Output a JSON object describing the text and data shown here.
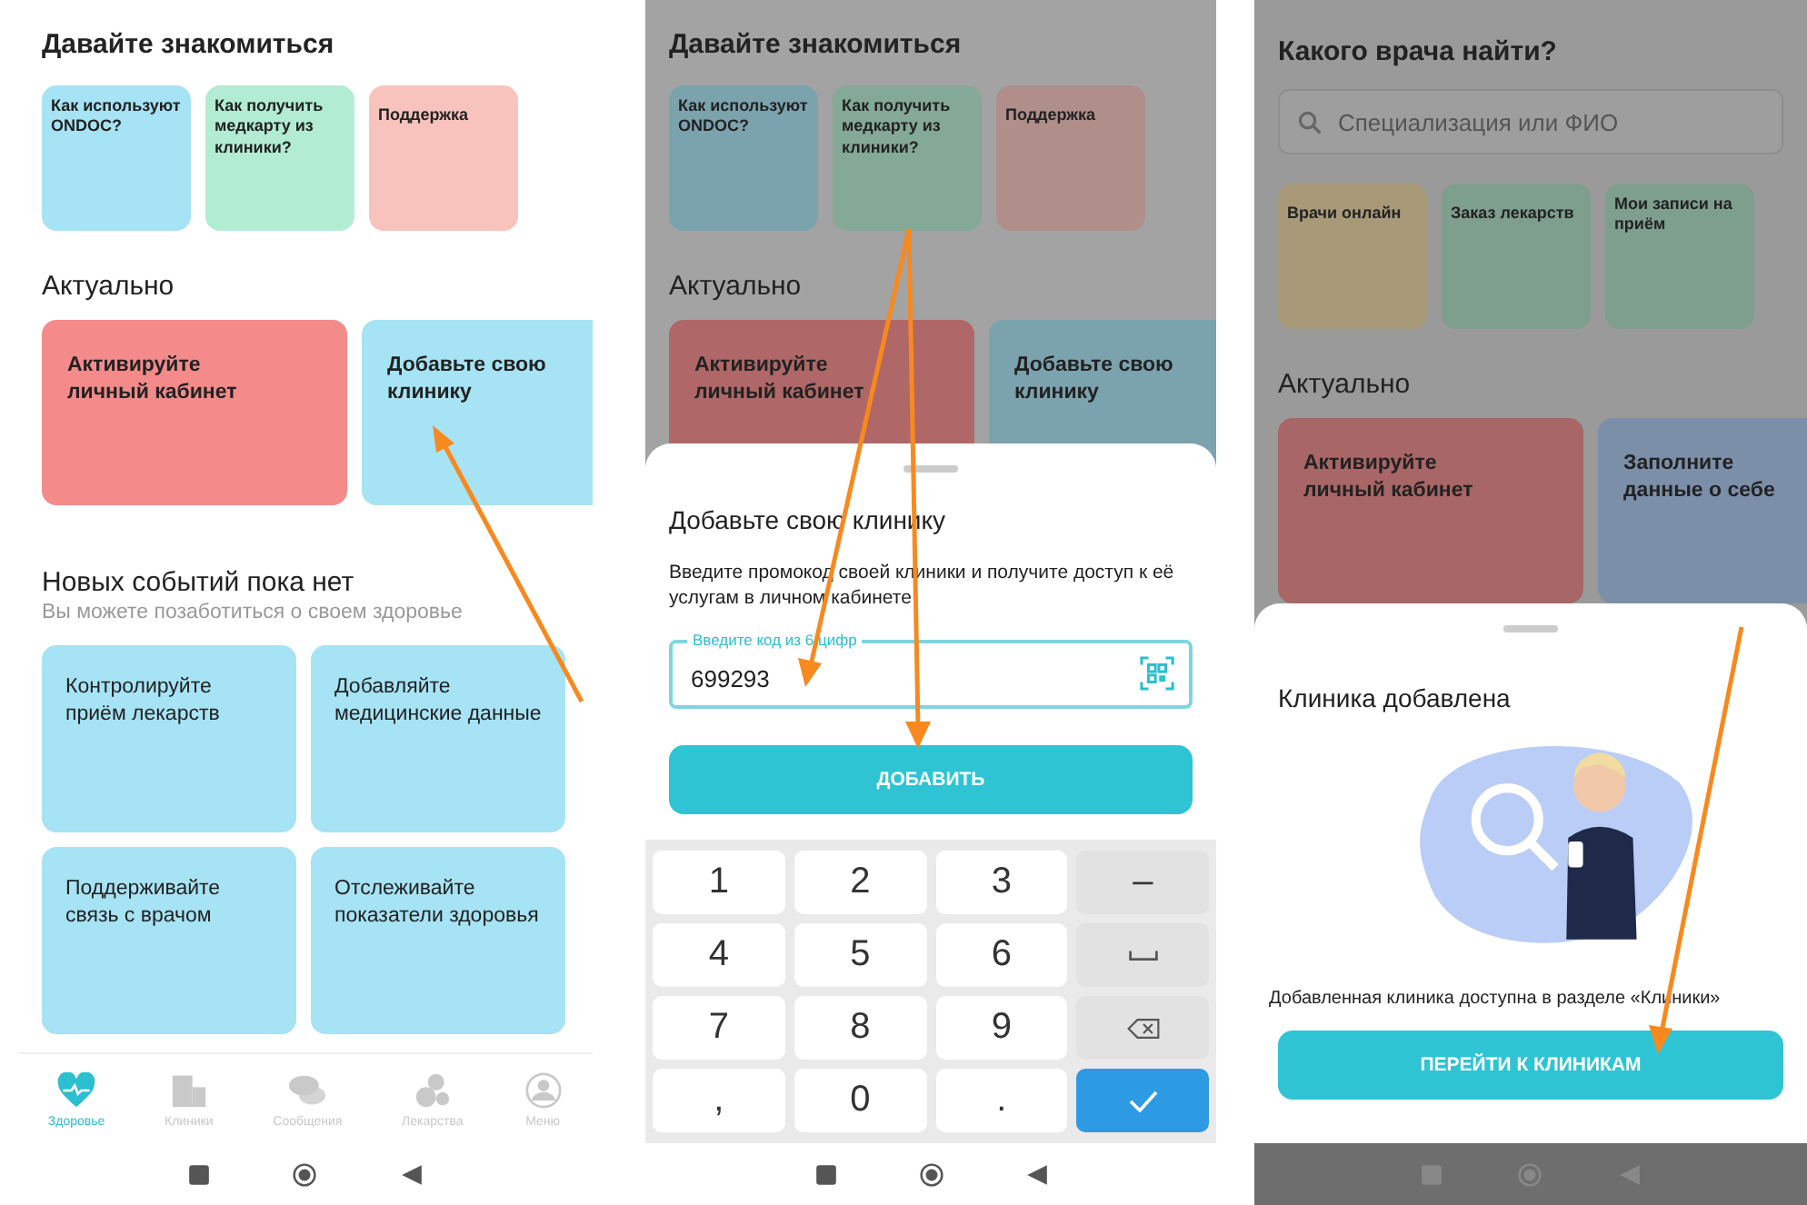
{
  "home": {
    "intro_title": "Давайте знакомиться",
    "intro_cards": [
      {
        "text": "Как используют ONDOC?",
        "color": "#a6e3f4"
      },
      {
        "text": "Как получить медкарту из клиники?",
        "color": "#b2ecd2"
      },
      {
        "text": "Поддержка",
        "color": "#f8c3bc"
      }
    ],
    "actual_title": "Актуально",
    "actual_cards": [
      {
        "text": "Активируйте личный кабинет",
        "color": "#f48a8a"
      },
      {
        "text": "Добавьте свою клинику",
        "color": "#a6e3f4"
      }
    ],
    "events_title": "Новых событий пока нет",
    "events_subtitle": "Вы можете позаботиться о своем здоровье",
    "tips": [
      "Контролируйте приём лекарств",
      "Добавляйте медицинские данные",
      "Поддерживайте связь с врачом",
      "Отслеживайте показатели здоровья"
    ],
    "nav": [
      {
        "label": "Здоровье",
        "selected": true
      },
      {
        "label": "Клиники",
        "selected": false
      },
      {
        "label": "Сообщения",
        "selected": false
      },
      {
        "label": "Лекарства",
        "selected": false
      },
      {
        "label": "Меню",
        "selected": false
      }
    ]
  },
  "add_clinic": {
    "background": {
      "intro_title": "Давайте знакомиться",
      "intro_cards": [
        {
          "text": "Как используют ONDOC?",
          "color": "#7ba3ae"
        },
        {
          "text": "Как получить медкарту из клиники?",
          "color": "#84a996"
        },
        {
          "text": "Поддержка",
          "color": "#b08e8a"
        }
      ],
      "actual_title": "Актуально",
      "actual_cards": [
        {
          "text": "Активируйте личный кабинет",
          "color": "#b06767"
        },
        {
          "text": "Добавьте свою клинику",
          "color": "#7ba3ae"
        }
      ]
    },
    "sheet": {
      "title": "Добавьте свою клинику",
      "description": "Введите промокод своей клиники и получите доступ к её услугам в личном кабинете",
      "field": {
        "label": "Введите код из 6 цифр",
        "value": "699293"
      },
      "button": "ДОБАВИТЬ"
    },
    "keypad": [
      {
        "kind": "digit",
        "label": "1"
      },
      {
        "kind": "digit",
        "label": "2"
      },
      {
        "kind": "digit",
        "label": "3"
      },
      {
        "kind": "symbol",
        "label": "–"
      },
      {
        "kind": "digit",
        "label": "4"
      },
      {
        "kind": "digit",
        "label": "5"
      },
      {
        "kind": "digit",
        "label": "6"
      },
      {
        "kind": "space"
      },
      {
        "kind": "digit",
        "label": "7"
      },
      {
        "kind": "digit",
        "label": "8"
      },
      {
        "kind": "digit",
        "label": "9"
      },
      {
        "kind": "backspace"
      },
      {
        "kind": "digit",
        "label": ","
      },
      {
        "kind": "digit",
        "label": "0"
      },
      {
        "kind": "digit",
        "label": "."
      },
      {
        "kind": "confirm"
      }
    ]
  },
  "clinic_added": {
    "background": {
      "title": "Какого врача найти?",
      "search": {
        "placeholder": "Специализация или ФИО"
      },
      "service_cards": [
        {
          "text": "Врачи онлайн",
          "color": "#a89a78"
        },
        {
          "text": "Заказ лекарств",
          "color": "#7e9e8e"
        },
        {
          "text": "Мои записи на приём",
          "color": "#7e9e8e"
        }
      ],
      "actual_title": "Актуально",
      "actual_cards": [
        {
          "text": "Активируйте личный кабинет",
          "color": "#a86666"
        },
        {
          "text": "Заполните данные о себе",
          "color": "#7c8fa8"
        }
      ]
    },
    "sheet": {
      "title": "Клиника добавлена",
      "message": "Добавленная клиника доступна в разделе «Клиники»",
      "button": "ПЕРЕЙТИ К КЛИНИКАМ"
    }
  }
}
